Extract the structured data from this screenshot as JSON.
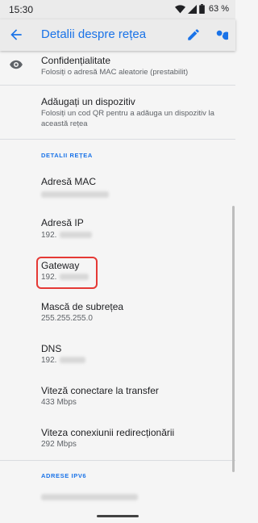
{
  "status_bar": {
    "time": "15:30",
    "battery": "63 %"
  },
  "app_bar": {
    "title": "Detalii despre rețea",
    "back_icon": "arrow-back-icon",
    "edit_icon": "edit-icon",
    "search_icon": "search-icon"
  },
  "privacy": {
    "title": "Confidențialitate",
    "subtitle": "Folosiți o adresă MAC aleatorie (prestabilit)",
    "icon": "eye-privacy-icon"
  },
  "add_device": {
    "title": "Adăugați un dispozitiv",
    "subtitle": "Folosiți un cod QR pentru a adăuga un dispozitiv la această rețea"
  },
  "details_section": "DETALII REȚEA",
  "details": {
    "mac": {
      "label": "Adresă MAC"
    },
    "ip": {
      "label": "Adresă IP",
      "value": "192."
    },
    "gateway": {
      "label": "Gateway",
      "value": "192."
    },
    "subnet": {
      "label": "Mască de subrețea",
      "value": "255.255.255.0"
    },
    "dns": {
      "label": "DNS",
      "value": "192."
    },
    "tx_speed": {
      "label": "Viteză conectare la transfer",
      "value": "433 Mbps"
    },
    "rx_speed": {
      "label": "Viteza conexiunii redirecționării",
      "value": "292 Mbps"
    }
  },
  "ipv6_section": "ADRESE IPV6",
  "colors": {
    "accent": "#1a73e8",
    "highlight": "#e53935",
    "background": "#f5f5f5"
  }
}
